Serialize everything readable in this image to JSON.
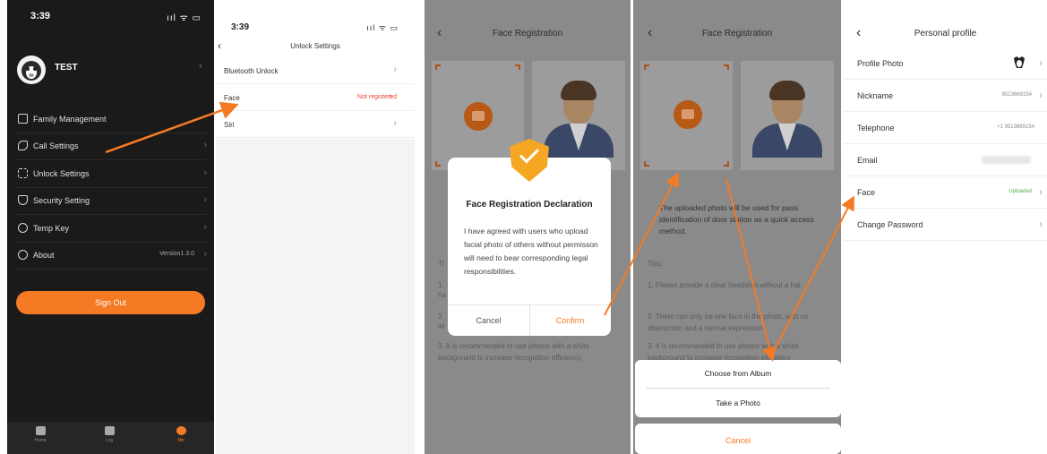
{
  "panel1": {
    "time": "3:39",
    "status_icons": "ııl ᯤ ▭",
    "user_name": "TEST",
    "menu": [
      {
        "label": "Family Management",
        "icon": "family-icon",
        "value": ""
      },
      {
        "label": "Call Settings",
        "icon": "phone-icon",
        "value": ""
      },
      {
        "label": "Unlock Settings",
        "icon": "grid-icon",
        "value": ""
      },
      {
        "label": "Security Setting",
        "icon": "shield-icon",
        "value": ""
      },
      {
        "label": "Temp Key",
        "icon": "key-icon",
        "value": ""
      },
      {
        "label": "About",
        "icon": "info-icon",
        "value": "Version1.3.0"
      }
    ],
    "sign_out": "Sign Out",
    "tabs": [
      {
        "label": "Home",
        "icon": "home-icon"
      },
      {
        "label": "Log",
        "icon": "log-icon"
      },
      {
        "label": "Me",
        "icon": "me-icon"
      }
    ],
    "colors": {
      "accent": "#f57a24",
      "background": "#1a1a1a"
    }
  },
  "panel2": {
    "time": "3:39",
    "status_icons": "ııl ᯤ ▭",
    "title": "Unlock Settings",
    "rows": [
      {
        "label": "Bluetooth Unlock",
        "value": ""
      },
      {
        "label": "Face",
        "value": "Not registered"
      },
      {
        "label": "Siri",
        "value": ""
      }
    ]
  },
  "panel3": {
    "title": "Face Registration",
    "modal": {
      "title": "Face Registration Declaration",
      "body": "I have agreed with users who upload facial photo of others without permisson will need to bear corresponding legal responsibilities.",
      "cancel": "Cancel",
      "confirm": "Confirm"
    },
    "tips_visible": "Ti",
    "tip_lines": [
      "1.",
      "ha",
      "2.",
      "wi",
      "3. It is recommended to use photos with a white background to increase recognition efficiency"
    ]
  },
  "panel4": {
    "title": "Face Registration",
    "description": "The uploaded photo will be used for pass identification of door station as a quick access method.",
    "tips_title": "Tips:",
    "tips": [
      "1. Please provide a clear headshot without a hat",
      "2. There can only be one face in the photo, with no obstruction and a normal expression.",
      "3. It is recommended to use photos with a white background to increase recognition efficiency"
    ],
    "sheet": {
      "album": "Choose from Album",
      "photo": "Take a Photo",
      "cancel": "Cancel"
    }
  },
  "panel5": {
    "title": "Personal profile",
    "rows": [
      {
        "label": "Profile Photo",
        "value": ""
      },
      {
        "label": "Nickname",
        "value": "9513669154"
      },
      {
        "label": "Telephone",
        "value": "+1 9513669154"
      },
      {
        "label": "Email",
        "value": ""
      },
      {
        "label": "Face",
        "value": "Uploaded"
      },
      {
        "label": "Change Password",
        "value": ""
      }
    ]
  }
}
